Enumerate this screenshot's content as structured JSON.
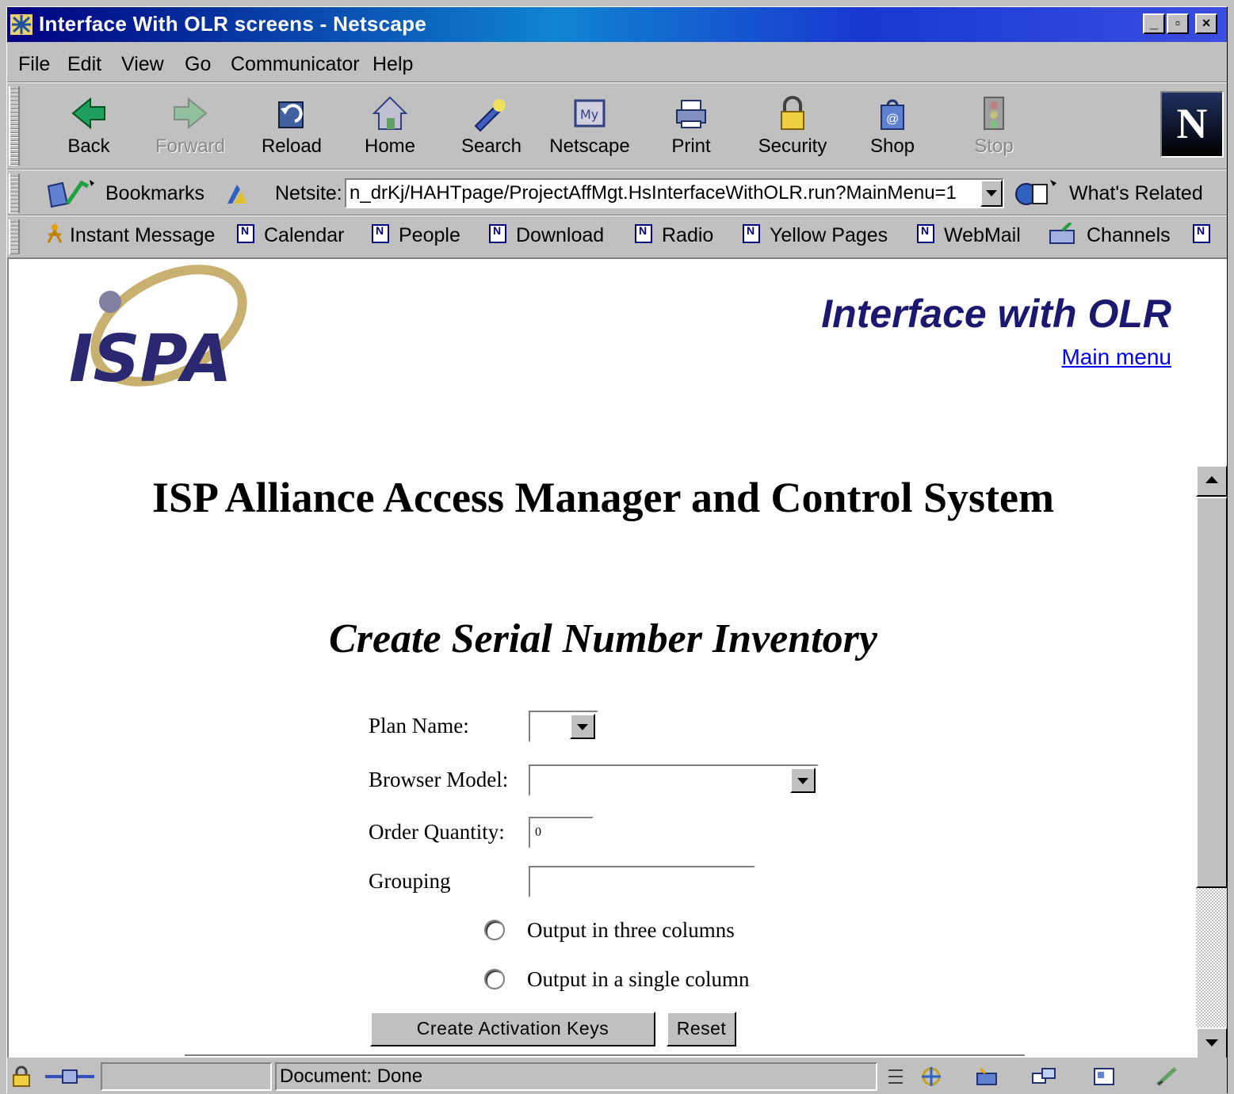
{
  "window": {
    "title": "Interface With OLR screens - Netscape",
    "controls": {
      "minimize": "_",
      "maximize": "▫",
      "close": "×"
    }
  },
  "menu": [
    "File",
    "Edit",
    "View",
    "Go",
    "Communicator",
    "Help"
  ],
  "toolbar": {
    "back": "Back",
    "forward": "Forward",
    "reload": "Reload",
    "home": "Home",
    "search": "Search",
    "netscape": "Netscape",
    "print": "Print",
    "security": "Security",
    "shop": "Shop",
    "stop": "Stop",
    "my_badge": "My",
    "logo_letter": "N"
  },
  "location": {
    "bookmarks": "Bookmarks",
    "netsite_label": "Netsite:",
    "url": "n_drKj/HAHTpage/ProjectAffMgt.HsInterfaceWithOLR.run?MainMenu=1",
    "whats_related": "What's Related"
  },
  "personal": {
    "instant_message": "Instant Message",
    "calendar": "Calendar",
    "people": "People",
    "download": "Download",
    "radio": "Radio",
    "yellow_pages": "Yellow Pages",
    "webmail": "WebMail",
    "channels": "Channels"
  },
  "page": {
    "logo_text": "ISPA",
    "header_title": "Interface with OLR",
    "main_menu_link": "Main menu",
    "system_title": "ISP Alliance Access Manager and Control System",
    "form_title": "Create Serial Number Inventory",
    "form": {
      "plan_name_label": "Plan Name:",
      "plan_name_value": "",
      "browser_model_label": "Browser Model:",
      "browser_model_value": "",
      "order_quantity_label": "Order Quantity:",
      "order_quantity_value": "0",
      "grouping_label": "Grouping",
      "grouping_value": "",
      "output_three_label": "Output in three columns",
      "output_single_label": "Output in a single column",
      "create_button": "Create Activation Keys",
      "reset_button": "Reset"
    }
  },
  "status": {
    "text": "Document: Done"
  },
  "colors": {
    "title_bar_start": "#000080",
    "title_bar_end": "#1084d0",
    "header_title": "#1c1870",
    "link": "#0000ee",
    "chrome": "#c0c0c0"
  }
}
